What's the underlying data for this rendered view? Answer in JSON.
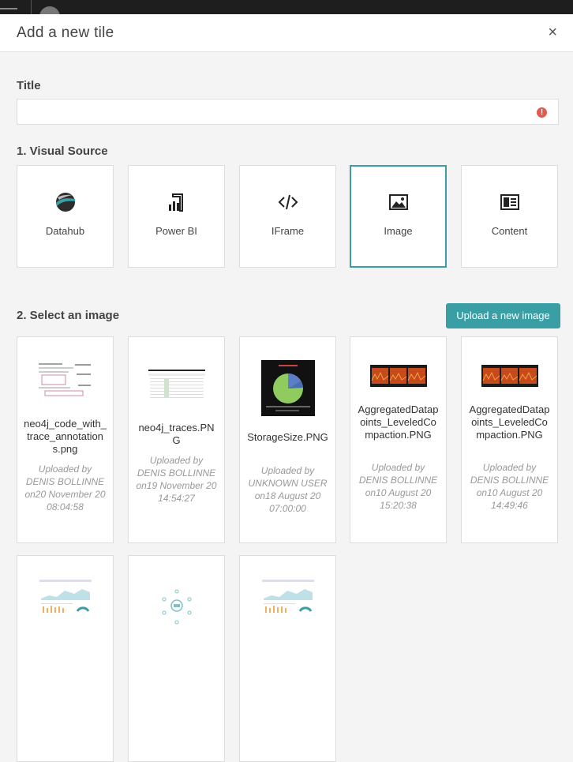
{
  "dialog": {
    "title": "Add a new tile",
    "close": "×"
  },
  "title_field": {
    "label": "Title",
    "value": "",
    "placeholder": "",
    "error": "!"
  },
  "visual_source": {
    "label": "1. Visual Source",
    "items": [
      {
        "label": "Datahub",
        "icon": "datahub-logo-icon"
      },
      {
        "label": "Power BI",
        "icon": "powerbi-icon"
      },
      {
        "label": "IFrame",
        "icon": "code-icon"
      },
      {
        "label": "Image",
        "icon": "image-icon",
        "selected": true
      },
      {
        "label": "Content",
        "icon": "article-icon"
      }
    ]
  },
  "images": {
    "label": "2. Select an image",
    "upload_label": "Upload a new image",
    "items": [
      {
        "name": "neo4j_code_with_trace_annotations.png",
        "meta": "Uploaded by DENIS BOLLINNE on20 November 20 08:04:58"
      },
      {
        "name": "neo4j_traces.PNG",
        "meta": "Uploaded by DENIS BOLLINNE on19 November 20 14:54:27"
      },
      {
        "name": "StorageSize.PNG",
        "meta": "Uploaded by UNKNOWN USER on18 August 20 07:00:00"
      },
      {
        "name": "AggregatedDatapoints_LeveledCompaction.PNG",
        "meta": "Uploaded by DENIS BOLLINNE on10 August 20 15:20:38"
      },
      {
        "name": "AggregatedDatapoints_LeveledCompaction.PNG",
        "meta": "Uploaded by DENIS BOLLINNE on10 August 20 14:49:46"
      },
      {
        "name": "",
        "meta": ""
      },
      {
        "name": "",
        "meta": ""
      },
      {
        "name": "",
        "meta": ""
      }
    ]
  },
  "colors": {
    "accent": "#3a9ea5",
    "error": "#e05a4e"
  }
}
